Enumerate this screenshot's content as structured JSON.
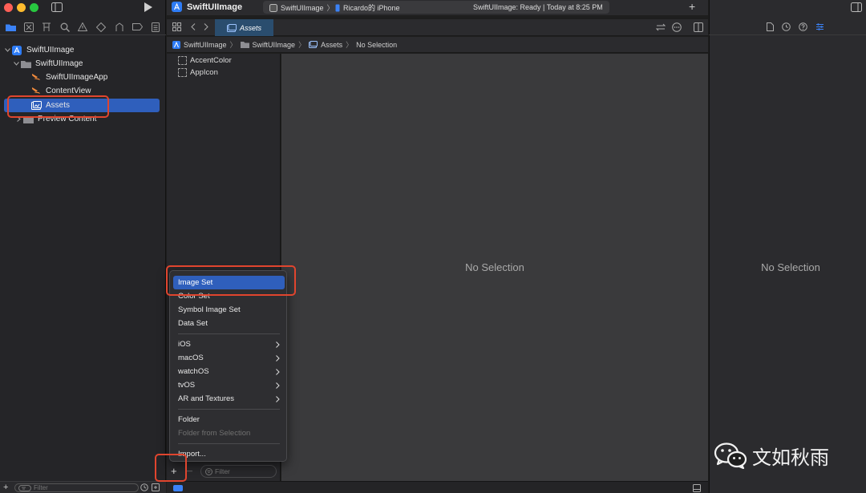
{
  "app": {
    "project_name": "SwiftUIImage",
    "scheme": "SwiftUIImage",
    "device": "Ricardo的 iPhone",
    "status": "SwiftUIImage: Ready | Today at 8:25 PM"
  },
  "navigator": {
    "tree": [
      {
        "label": "SwiftUIImage",
        "level": 0,
        "icon": "app-project-icon"
      },
      {
        "label": "SwiftUIImage",
        "level": 1,
        "icon": "folder-icon"
      },
      {
        "label": "SwiftUIImageApp",
        "level": 2,
        "icon": "swift-file-icon"
      },
      {
        "label": "ContentView",
        "level": 2,
        "icon": "swift-file-icon"
      },
      {
        "label": "Assets",
        "level": 2,
        "icon": "asset-catalog-icon",
        "selected": true
      },
      {
        "label": "Preview Content",
        "level": 2,
        "icon": "folder-icon"
      }
    ],
    "filter_placeholder": "Filter"
  },
  "editor": {
    "tab_label": "Assets",
    "breadcrumb": [
      "SwiftUIImage",
      "SwiftUIImage",
      "Assets",
      "No Selection"
    ],
    "assets": [
      "AccentColor",
      "AppIcon"
    ],
    "filter_placeholder": "Filter",
    "empty_message": "No Selection"
  },
  "inspector": {
    "empty_message": "No Selection"
  },
  "context_menu": {
    "groups": [
      [
        "Image Set",
        "Color Set",
        "Symbol Image Set",
        "Data Set"
      ],
      [
        "iOS",
        "macOS",
        "watchOS",
        "tvOS",
        "AR and Textures"
      ],
      [
        "Folder",
        "Folder from Selection"
      ],
      [
        "Import..."
      ]
    ],
    "selected": "Image Set",
    "disabled": [
      "Folder from Selection"
    ],
    "submenus": [
      "iOS",
      "macOS",
      "watchOS",
      "tvOS",
      "AR and Textures"
    ]
  },
  "bottom": {
    "add_symbol": "+",
    "remove_symbol": "—"
  },
  "watermark": {
    "text": "文如秋雨"
  },
  "colors": {
    "accent": "#2f5fbc",
    "annotation": "#e0452e",
    "swift": "#f08a3c",
    "folder": "#8e8e93"
  }
}
